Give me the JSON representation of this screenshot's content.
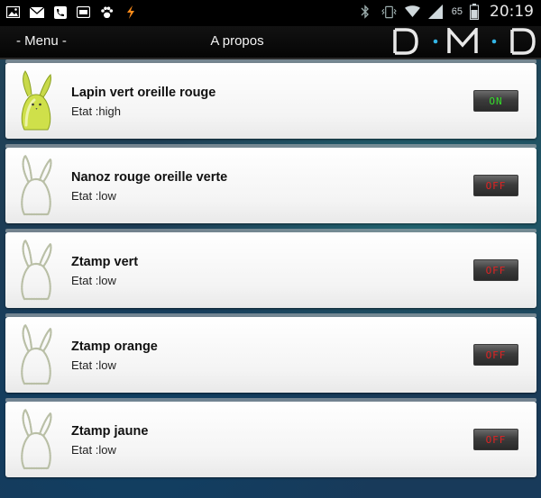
{
  "status_bar": {
    "icons_left": [
      "gallery-icon",
      "mail-icon",
      "phone-app-icon",
      "media-icon",
      "paw-icon",
      "flash-icon"
    ],
    "icons_right": [
      "bluetooth-icon",
      "vibrate-icon",
      "wifi-icon",
      "signal-icon",
      "battery-icon"
    ],
    "battery_level": "65",
    "time": "20:19"
  },
  "action_bar": {
    "menu_label": "- Menu -",
    "title": "A propos",
    "logo_text": "DMD"
  },
  "devices": [
    {
      "name": "Lapin vert oreille rouge",
      "state_label": "Etat :high",
      "toggle": "ON",
      "icon": "rabbit-green-icon"
    },
    {
      "name": "Nanoz rouge oreille verte",
      "state_label": "Etat :low",
      "toggle": "OFF",
      "icon": "rabbit-outline-icon"
    },
    {
      "name": "Ztamp vert",
      "state_label": "Etat :low",
      "toggle": "OFF",
      "icon": "rabbit-outline-icon"
    },
    {
      "name": "Ztamp orange",
      "state_label": "Etat :low",
      "toggle": "OFF",
      "icon": "rabbit-outline-icon"
    },
    {
      "name": "Ztamp jaune",
      "state_label": "Etat :low",
      "toggle": "OFF",
      "icon": "rabbit-outline-icon"
    }
  ],
  "colors": {
    "on_text": "#35e02a",
    "off_text": "#e02222",
    "accent_blue": "#33b5e5"
  }
}
